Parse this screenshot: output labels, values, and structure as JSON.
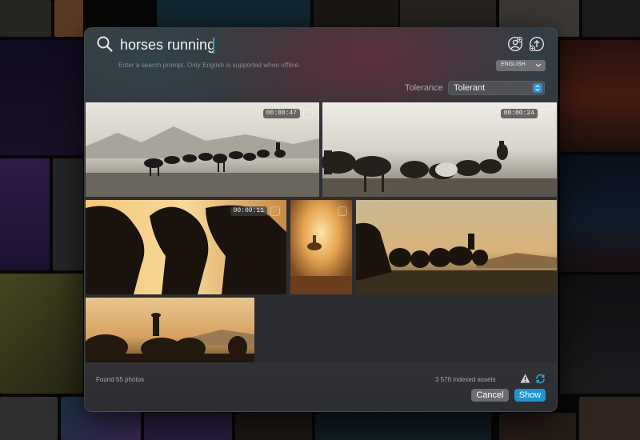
{
  "search": {
    "query": "horses running",
    "hint": "Enter a search prompt. Only English is supported when offline."
  },
  "header_icons": [
    "face-search-icon",
    "upload-search-icon"
  ],
  "language": {
    "selected": "ENGLISH"
  },
  "tolerance": {
    "label": "Tolerance",
    "selected": "Tolerant"
  },
  "results": [
    {
      "duration": "00:00:47",
      "is_video": true
    },
    {
      "duration": "00:00:24",
      "is_video": true
    },
    {
      "duration": "00:00:11",
      "is_video": true
    },
    {
      "duration": "",
      "is_video": false
    },
    {
      "duration": "",
      "is_video": false
    },
    {
      "duration": "",
      "is_video": false
    }
  ],
  "footer": {
    "found": "Found 55 photos",
    "indexed": "3 576 indexed assets",
    "cancel_label": "Cancel",
    "show_label": "Show"
  },
  "colors": {
    "accent": "#1f94d2",
    "caret": "#2da6d6",
    "sunset": "#e7a24e",
    "dusk": "#c9c4b8"
  }
}
